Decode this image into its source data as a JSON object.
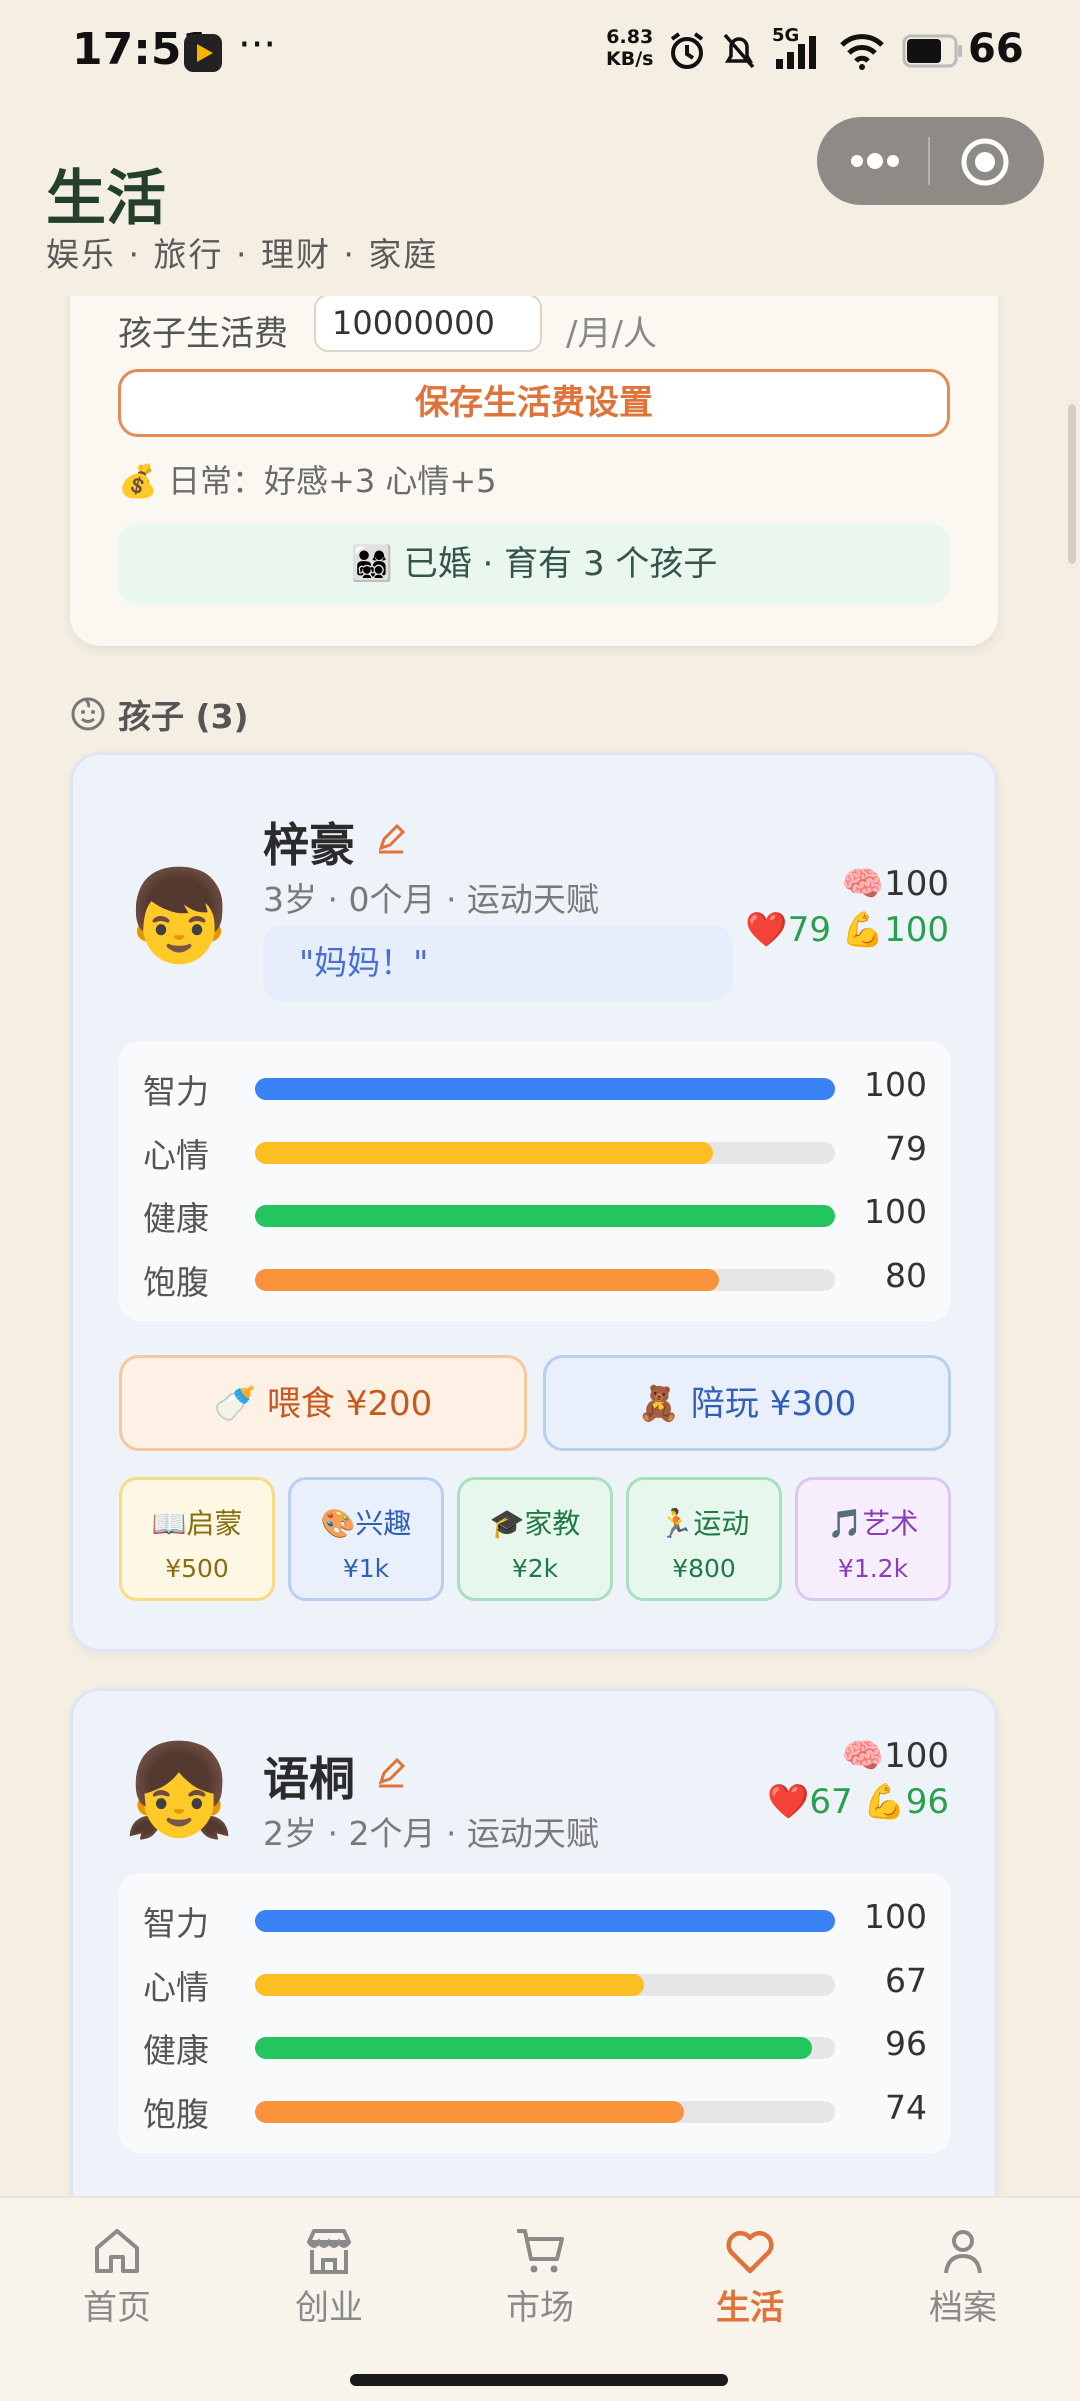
{
  "status_bar": {
    "time": "17:51",
    "dots": "···",
    "net_speed_value": "6.83",
    "net_speed_unit": "KB/s",
    "network": "5G",
    "battery": "66"
  },
  "header": {
    "title": "生活",
    "subtitle": "娱乐 · 旅行 · 理财 · 家庭"
  },
  "living_fee": {
    "label": "孩子生活费",
    "value": "10000000",
    "unit": "/月/人",
    "save_label": "保存生活费设置",
    "daily_effect": "💰 日常：好感+3 心情+5",
    "family_status": "👨‍👩‍👧‍👦 已婚 · 育有 3 个孩子"
  },
  "children_header": "孩子 (3)",
  "children": [
    {
      "avatar": "👦",
      "name": "梓豪",
      "meta": "3岁 · 0个月 · 运动天赋",
      "quote": "\"妈妈！\"",
      "iq_display": "🧠100",
      "mood_health_display": "❤️79 💪100",
      "bars": [
        {
          "label": "智力",
          "value": 100,
          "color": "#3b82f6"
        },
        {
          "label": "心情",
          "value": 79,
          "color": "#fbbf24"
        },
        {
          "label": "健康",
          "value": 100,
          "color": "#22c55e"
        },
        {
          "label": "饱腹",
          "value": 80,
          "color": "#fb923c"
        }
      ],
      "feed_label": "🍼 喂食 ¥200",
      "play_label": "🧸 陪玩 ¥300",
      "courses": [
        {
          "name": "📖启蒙",
          "price": "¥500",
          "bg": "#fdf7e4",
          "border": "#f5dc85",
          "color": "#8a6d10"
        },
        {
          "name": "🎨兴趣",
          "price": "¥1k",
          "bg": "#e9f0fb",
          "border": "#b9cff0",
          "color": "#2f5fb8"
        },
        {
          "name": "🎓家教",
          "price": "¥2k",
          "bg": "#e8f7ee",
          "border": "#a8e0bd",
          "color": "#1f7a45"
        },
        {
          "name": "🏃运动",
          "price": "¥800",
          "bg": "#e8f7ee",
          "border": "#a8e0bd",
          "color": "#1f7a45"
        },
        {
          "name": "🎵艺术",
          "price": "¥1.2k",
          "bg": "#f6eefc",
          "border": "#dcc6f2",
          "color": "#8a3fb8"
        }
      ]
    },
    {
      "avatar": "👧",
      "name": "语桐",
      "meta": "2岁 · 2个月 · 运动天赋",
      "iq_display": "🧠100",
      "mood_health_display": "❤️67 💪96",
      "bars": [
        {
          "label": "智力",
          "value": 100,
          "color": "#3b82f6"
        },
        {
          "label": "心情",
          "value": 67,
          "color": "#fbbf24"
        },
        {
          "label": "健康",
          "value": 96,
          "color": "#22c55e"
        },
        {
          "label": "饱腹",
          "value": 74,
          "color": "#fb923c"
        }
      ]
    }
  ],
  "tabs": [
    {
      "label": "首页",
      "icon": "home-icon",
      "active": false
    },
    {
      "label": "创业",
      "icon": "store-icon",
      "active": false
    },
    {
      "label": "市场",
      "icon": "cart-icon",
      "active": false
    },
    {
      "label": "生活",
      "icon": "heart-icon",
      "active": true
    },
    {
      "label": "档案",
      "icon": "user-icon",
      "active": false
    }
  ],
  "colors": {
    "accent": "#e0733a",
    "background": "#f5efe3",
    "title_green": "#24402c"
  }
}
